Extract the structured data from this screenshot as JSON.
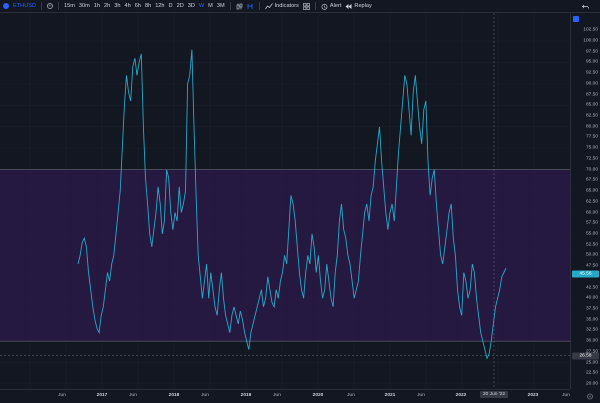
{
  "toolbar": {
    "symbol": "ETHUSD",
    "intervals": [
      "15m",
      "30m",
      "1h",
      "2h",
      "3h",
      "4h",
      "6h",
      "8h",
      "12h",
      "D",
      "2D",
      "3D",
      "W",
      "M",
      "3M"
    ],
    "active_interval": "W",
    "indicators_label": "Indicators",
    "alert_label": "Alert",
    "replay_label": "Replay"
  },
  "price_axis": {
    "labels": [
      "102.50",
      "100.00",
      "97.50",
      "95.00",
      "92.50",
      "90.00",
      "87.50",
      "85.00",
      "82.50",
      "80.00",
      "77.50",
      "75.00",
      "72.50",
      "70.00",
      "67.50",
      "65.00",
      "62.50",
      "60.00",
      "57.50",
      "55.00",
      "52.50",
      "50.00",
      "47.50",
      "45.00",
      "42.50",
      "40.00",
      "37.50",
      "35.00",
      "32.50",
      "30.00",
      "27.50",
      "25.00",
      "22.50",
      "20.00"
    ],
    "current_value": "45.56",
    "crosshair_value": "26.58"
  },
  "time_axis": {
    "labels": [
      {
        "text": "Jun",
        "year": false
      },
      {
        "text": "2017",
        "year": true
      },
      {
        "text": "Jun",
        "year": false
      },
      {
        "text": "2018",
        "year": true
      },
      {
        "text": "Jun",
        "year": false
      },
      {
        "text": "2019",
        "year": true
      },
      {
        "text": "Jun",
        "year": false
      },
      {
        "text": "2020",
        "year": true
      },
      {
        "text": "Jun",
        "year": false
      },
      {
        "text": "2021",
        "year": true
      },
      {
        "text": "Jun",
        "year": false
      },
      {
        "text": "2022",
        "year": true
      },
      {
        "text": "2023",
        "year": true
      },
      {
        "text": "Jun",
        "year": false
      }
    ],
    "crosshair_date": "20 Jun '22"
  },
  "colors": {
    "background": "#131722",
    "band_fill": "#2a1a47",
    "band_line": "#787b86",
    "series": "#26a9c9",
    "accent": "#2962ff",
    "current_tag": "#26a9c9"
  },
  "chart_data": {
    "type": "line",
    "ylim": [
      20,
      103.5
    ],
    "band": {
      "upper": 70,
      "lower": 30
    },
    "series": [
      {
        "values": [
          48,
          50,
          53,
          54,
          52,
          46,
          42,
          38,
          35,
          33,
          32,
          36,
          38,
          42,
          46,
          44,
          48,
          50,
          55,
          60,
          65,
          75,
          85,
          92,
          88,
          86,
          94,
          96,
          92,
          95,
          97,
          80,
          68,
          62,
          55,
          52,
          56,
          60,
          66,
          62,
          55,
          58,
          70,
          68,
          60,
          56,
          60,
          58,
          66,
          60,
          62,
          65,
          90,
          92,
          98,
          80,
          64,
          50,
          45,
          40,
          44,
          48,
          40,
          46,
          42,
          38,
          36,
          42,
          46,
          40,
          36,
          34,
          32,
          36,
          38,
          36,
          34,
          37,
          35,
          32,
          30,
          28,
          32,
          34,
          36,
          38,
          40,
          42,
          38,
          40,
          45,
          42,
          39,
          38,
          42,
          40,
          44,
          46,
          50,
          48,
          56,
          64,
          62,
          58,
          52,
          46,
          42,
          40,
          46,
          50,
          48,
          55,
          52,
          46,
          50,
          44,
          40,
          42,
          48,
          44,
          40,
          38,
          46,
          50,
          58,
          62,
          56,
          54,
          50,
          48,
          44,
          40,
          42,
          44,
          50,
          55,
          60,
          62,
          58,
          64,
          66,
          72,
          76,
          80,
          72,
          66,
          60,
          56,
          60,
          62,
          58,
          66,
          74,
          80,
          86,
          92,
          90,
          84,
          78,
          88,
          92,
          86,
          80,
          76,
          84,
          86,
          72,
          64,
          68,
          70,
          62,
          56,
          50,
          48,
          52,
          56,
          60,
          62,
          54,
          50,
          42,
          38,
          36,
          46,
          44,
          40,
          42,
          48,
          46,
          40,
          36,
          32,
          30,
          28,
          26,
          27,
          30,
          34,
          38,
          40,
          42,
          45,
          46,
          47
        ]
      }
    ]
  }
}
